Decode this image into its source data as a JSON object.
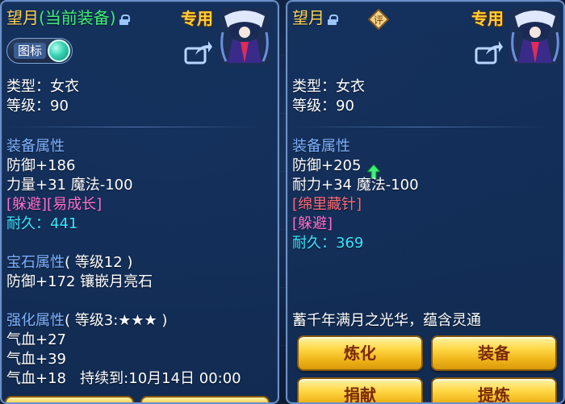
{
  "left": {
    "title": "望月",
    "status": "(当前装备)",
    "tag": "专用",
    "toggle_label": "图标",
    "type_line": "类型：女衣",
    "level_line": "等级：90",
    "equip_attr_head": "装备属性",
    "defense_line": "防御+186",
    "stats_line": "力量+31 魔法-100",
    "special_line": "[躲避][易成长]",
    "durability_label": "耐久：",
    "durability_value": "441",
    "gem_head": "宝石属性",
    "gem_level": "( 等级12 )",
    "gem_line": "防御+172 镶嵌月亮石",
    "enhance_head": "强化属性",
    "enhance_level": "( 等级3:★★★ )",
    "enhance_lines": [
      "气血+27",
      "气血+39"
    ],
    "enhance_last": "气血+18",
    "duration_line": "持续到:10月14日 00:00"
  },
  "right": {
    "title": "望月",
    "badge": "评",
    "tag": "专用",
    "type_line": "类型：女衣",
    "level_line": "等级：90",
    "equip_attr_head": "装备属性",
    "defense_line": "防御+205",
    "stats_line": "耐力+34 魔法-100",
    "special_1": "[绵里藏针]",
    "special_2": "[躲避]",
    "durability_label": "耐久：",
    "durability_value": "369",
    "flavor": "蓄千年满月之光华，蕴含灵通",
    "buttons": {
      "refine": "炼化",
      "equip": "装备",
      "donate": "捐献",
      "extract": "提炼"
    }
  },
  "colors": {
    "gold_title": "#ffd45a",
    "attr_head": "#7fb2ff",
    "special_pink": "#ff6fd1",
    "special_red": "#ff6a78",
    "durability": "#39e6ff",
    "upgrade_arrow": "#3ff076",
    "button_gold": "#f0b519"
  },
  "icons": {
    "lock": "lock-icon",
    "share": "share-icon",
    "upgrade": "up-arrow-icon",
    "portrait": "character-portrait"
  }
}
